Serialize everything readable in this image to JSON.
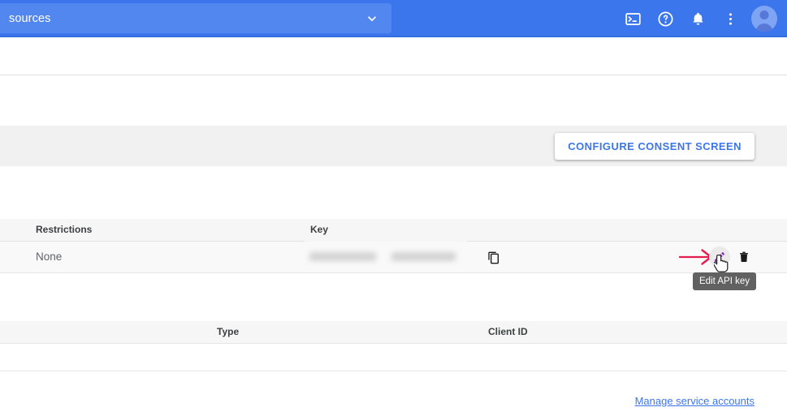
{
  "topbar": {
    "project_selector": {
      "name": "sources",
      "chevron_icon": "chevron-down-icon"
    },
    "actions": [
      {
        "icon": "cloud-shell-terminal-icon",
        "label": "Activate Cloud Shell"
      },
      {
        "icon": "help-question-icon",
        "label": "Help"
      },
      {
        "icon": "notifications-bell-icon",
        "label": "Notifications"
      },
      {
        "icon": "more-vert-dots-icon",
        "label": "More options"
      }
    ],
    "avatar": {
      "icon": "account-avatar-icon",
      "label": "Account"
    },
    "background_color": "#3b76ed",
    "selector_color": "#5287f0"
  },
  "consent_band": {
    "button_label": "CONFIGURE CONSENT SCREEN",
    "button_color": "#3b76ed",
    "band_color": "#f1f1f1"
  },
  "api_keys_table": {
    "columns": [
      "Restrictions",
      "Key"
    ],
    "rows": [
      {
        "restrictions": "None",
        "key": "",
        "key_redacted": true,
        "copy_icon": "copy-content-icon",
        "edit_icon": "edit-pencil-icon",
        "delete_icon": "delete-trash-icon"
      }
    ]
  },
  "annotation": {
    "arrow_icon": "red-arrow-right-icon",
    "arrow_color": "#e51c4e",
    "cursor_icon": "pointer-hand-cursor-icon"
  },
  "tooltip": {
    "text": "Edit API key",
    "background": "#616161"
  },
  "oauth_table": {
    "columns": [
      "Type",
      "Client ID"
    ],
    "rows": []
  },
  "footer": {
    "link_label": "Manage service accounts",
    "link_color": "#3b76ed"
  }
}
